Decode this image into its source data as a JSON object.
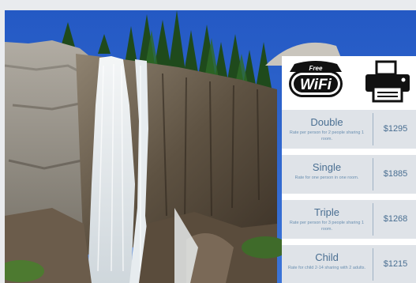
{
  "colors": {
    "sky": "#2b62c6",
    "panel_row": "#dfe3e8",
    "text_primary": "#4a6f92",
    "text_secondary": "#6a8fb0"
  },
  "amenities": {
    "wifi": {
      "icon": "wifi-icon",
      "badge_text": "Free",
      "logo_text": "WiFi"
    },
    "printer": {
      "icon": "printer-icon"
    }
  },
  "rates": [
    {
      "name": "Double",
      "description": "Rate per person for 2 people sharing 1 room.",
      "price": "$1295"
    },
    {
      "name": "Single",
      "description": "Rate for one person in one room.",
      "price": "$1885"
    },
    {
      "name": "Triple",
      "description": "Rate per person for 3 people sharing 1 room.",
      "price": "$1268"
    },
    {
      "name": "Child",
      "description": "Rate for child 2-14 sharing with 2 adults.",
      "price": "$1215"
    }
  ]
}
